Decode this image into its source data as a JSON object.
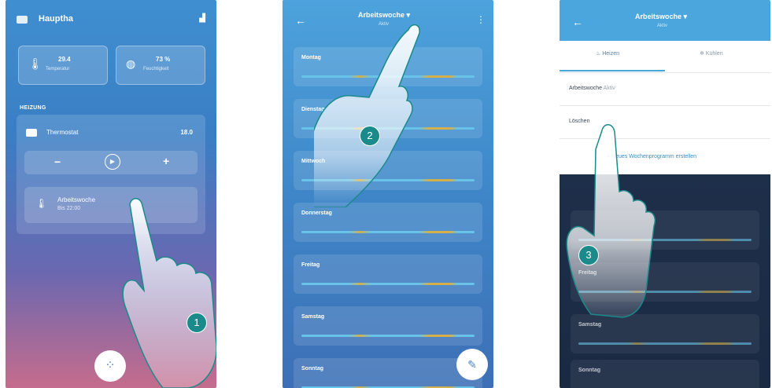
{
  "phone1": {
    "title": "Hauptha",
    "sensors": [
      {
        "icon": "thermometer-icon",
        "value": "29.4",
        "label": "Temperatur"
      },
      {
        "icon": "humidity-icon",
        "value": "73 %",
        "label": "Feuchtigkeit"
      }
    ],
    "section_label": "HEIZUNG",
    "zone": {
      "name": "Thermostat",
      "temp": "18.0"
    },
    "controls": {
      "minus": "−",
      "plus": "+"
    },
    "mode": {
      "line1": "Arbeitswoche",
      "line2": "Bis 22:00"
    },
    "badge": "1"
  },
  "phone2": {
    "title": "Arbeitswoche ▾",
    "subtitle": "Aktiv",
    "days": [
      "Montag",
      "Dienstag",
      "Mittwoch",
      "Donnerstag",
      "Freitag",
      "Samstag",
      "Sonntag"
    ],
    "badge": "2"
  },
  "phone3": {
    "title": "Arbeitswoche ▾",
    "subtitle": "Aktiv",
    "tabs": [
      "Heizen",
      "Kühlen"
    ],
    "rows": [
      {
        "text": "Arbeitswoche",
        "dim": "Aktiv"
      },
      {
        "text": "Löschen"
      }
    ],
    "link": "+ Neues Wochenprogramm erstellen",
    "dark_days": [
      "Freitag",
      "Samstag",
      "Sonntag"
    ],
    "badge": "3"
  },
  "colors": {
    "accent": "#4aa6dc",
    "badge": "#1a8a8a",
    "bar_warm": "#d5b04a",
    "bar_cool": "#67c3e8"
  }
}
